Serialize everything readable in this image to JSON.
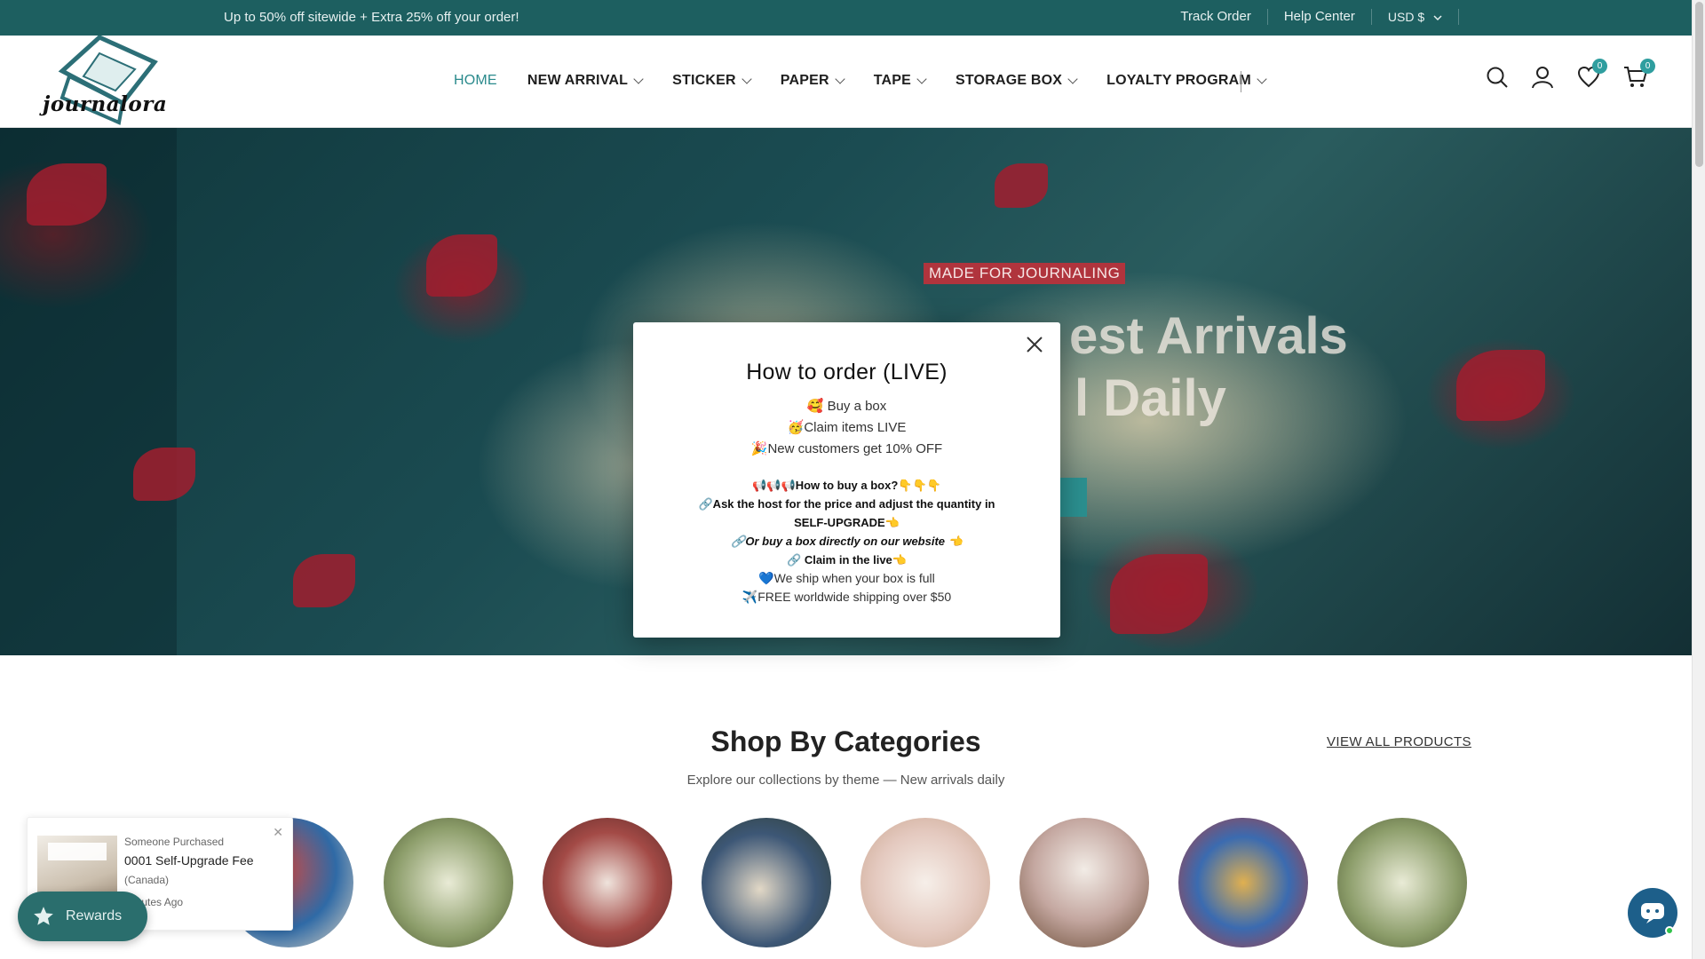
{
  "announcement": {
    "promo": "Up to 50% off sitewide + Extra 25% off your order!",
    "track_order": "Track Order",
    "help_center": "Help Center",
    "currency": "USD $"
  },
  "header": {
    "logo_text": "journalora",
    "nav": [
      {
        "label": "HOME",
        "active": true
      },
      {
        "label": "NEW ARRIVAL"
      },
      {
        "label": "STICKER"
      },
      {
        "label": "PAPER"
      },
      {
        "label": "TAPE"
      },
      {
        "label": "STORAGE BOX"
      },
      {
        "label": "LOYALTY PROGRAM"
      }
    ],
    "wishlist_count": "0",
    "cart_count": "0",
    "icons": [
      "search-icon",
      "account-icon",
      "heart-icon",
      "cart-icon"
    ]
  },
  "hero": {
    "tag": "MADE FOR JOURNALING",
    "title_line1": "est Arrivals",
    "title_line2": "l Daily"
  },
  "modal": {
    "title": "How to order (LIVE)",
    "lines": [
      "🥰 Buy a box",
      "🥳Claim items LIVE",
      "🎉New customers get 10% OFF"
    ],
    "how_to_buy": "📢📢📢How to buy a box?👇👇👇",
    "ask_host": "🔗Ask the host for the price and adjust the quantity in SELF-UPGRADE👈",
    "buy_direct": "🔗Or buy a box directly on our website 👈",
    "claim_live": "🔗 Claim in the live👈",
    "ship_full": "💙We ship when your box is full",
    "free_ship": "✈️FREE worldwide shipping over $50"
  },
  "categories": {
    "title": "Shop By Categories",
    "subtitle": "Explore our collections by theme — New arrivals daily",
    "view_all": "VIEW ALL PRODUCTS"
  },
  "purchase_popup": {
    "line1": "Someone Purchased",
    "product": "0001 Self-Upgrade Fee",
    "location": "(Canada)",
    "time": "Minutes Ago"
  },
  "rewards": {
    "label": "Rewards"
  },
  "colors": {
    "brand": "#1d5f60",
    "accent": "#2a8a8c",
    "tag_red": "#b0343d"
  }
}
